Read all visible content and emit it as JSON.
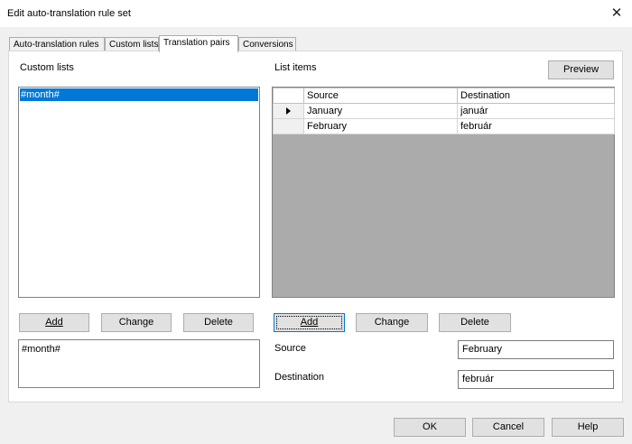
{
  "window": {
    "title": "Edit auto-translation rule set",
    "close_glyph": "✕"
  },
  "tabs": [
    {
      "label": "Auto-translation rules",
      "active": false
    },
    {
      "label": "Custom lists",
      "active": false
    },
    {
      "label": "Translation pairs",
      "active": true
    },
    {
      "label": "Conversions",
      "active": false
    }
  ],
  "left": {
    "heading": "Custom lists",
    "list_items": [
      "#month#"
    ],
    "selected_index": 0,
    "buttons": {
      "add": "Add",
      "change": "Change",
      "delete": "Delete"
    },
    "memo_text": "#month#"
  },
  "right": {
    "heading": "List items",
    "preview_button": "Preview",
    "grid": {
      "columns": [
        "Source",
        "Destination"
      ],
      "rows": [
        {
          "source": "January",
          "destination": "január",
          "current": true
        },
        {
          "source": "February",
          "destination": "február",
          "current": false
        }
      ]
    },
    "buttons": {
      "add": "Add",
      "change": "Change",
      "delete": "Delete"
    },
    "source_label": "Source",
    "source_value": "February",
    "destination_label": "Destination",
    "destination_value": "február"
  },
  "footer": {
    "ok": "OK",
    "cancel": "Cancel",
    "help": "Help"
  },
  "colors": {
    "selection": "#0078d7",
    "grid_background": "#ababab",
    "dialog_background": "#f0f0f0"
  }
}
